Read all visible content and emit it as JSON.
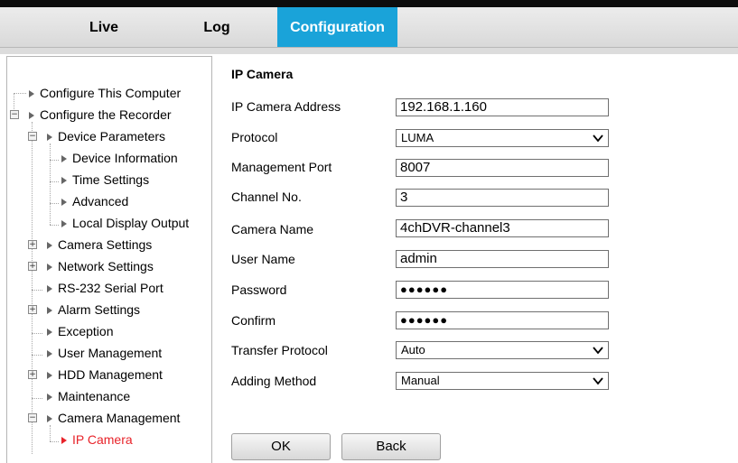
{
  "nav": {
    "tabs": [
      {
        "label": "Live",
        "active": false
      },
      {
        "label": "Log",
        "active": false
      },
      {
        "label": "Configuration",
        "active": true
      }
    ],
    "active_color": "#1aa3d9"
  },
  "sidebar": {
    "items": [
      {
        "label": "Configure This Computer",
        "level": 0,
        "expandable": false
      },
      {
        "label": "Configure the Recorder",
        "level": 0,
        "expandable": true,
        "expanded": true
      },
      {
        "label": "Device Parameters",
        "level": 1,
        "expandable": true,
        "expanded": true
      },
      {
        "label": "Device Information",
        "level": 2,
        "expandable": false
      },
      {
        "label": "Time Settings",
        "level": 2,
        "expandable": false
      },
      {
        "label": "Advanced",
        "level": 2,
        "expandable": false
      },
      {
        "label": "Local Display Output",
        "level": 2,
        "expandable": false
      },
      {
        "label": "Camera Settings",
        "level": 1,
        "expandable": true,
        "expanded": false
      },
      {
        "label": "Network Settings",
        "level": 1,
        "expandable": true,
        "expanded": false
      },
      {
        "label": "RS-232 Serial Port",
        "level": 1,
        "expandable": false
      },
      {
        "label": "Alarm Settings",
        "level": 1,
        "expandable": true,
        "expanded": false
      },
      {
        "label": "Exception",
        "level": 1,
        "expandable": false
      },
      {
        "label": "User Management",
        "level": 1,
        "expandable": false
      },
      {
        "label": "HDD Management",
        "level": 1,
        "expandable": true,
        "expanded": false
      },
      {
        "label": "Maintenance",
        "level": 1,
        "expandable": false
      },
      {
        "label": "Camera Management",
        "level": 1,
        "expandable": true,
        "expanded": true
      },
      {
        "label": "IP Camera",
        "level": 2,
        "expandable": false,
        "active": true
      }
    ],
    "active_color": "#e8232a"
  },
  "form": {
    "title": "IP Camera",
    "ip_address": {
      "label": "IP Camera Address",
      "value": "192.168.1.160"
    },
    "protocol": {
      "label": "Protocol",
      "value": "LUMA"
    },
    "management_port": {
      "label": "Management Port",
      "value": "8007"
    },
    "channel_no": {
      "label": "Channel No.",
      "value": "3"
    },
    "camera_name": {
      "label": "Camera Name",
      "value": "4chDVR-channel3"
    },
    "user_name": {
      "label": "User Name",
      "value": "admin"
    },
    "password": {
      "label": "Password",
      "value": "●●●●●●"
    },
    "confirm": {
      "label": "Confirm",
      "value": "●●●●●●"
    },
    "transfer_protocol": {
      "label": "Transfer Protocol",
      "value": "Auto"
    },
    "adding_method": {
      "label": "Adding Method",
      "value": "Manual"
    }
  },
  "buttons": {
    "ok": "OK",
    "back": "Back"
  }
}
